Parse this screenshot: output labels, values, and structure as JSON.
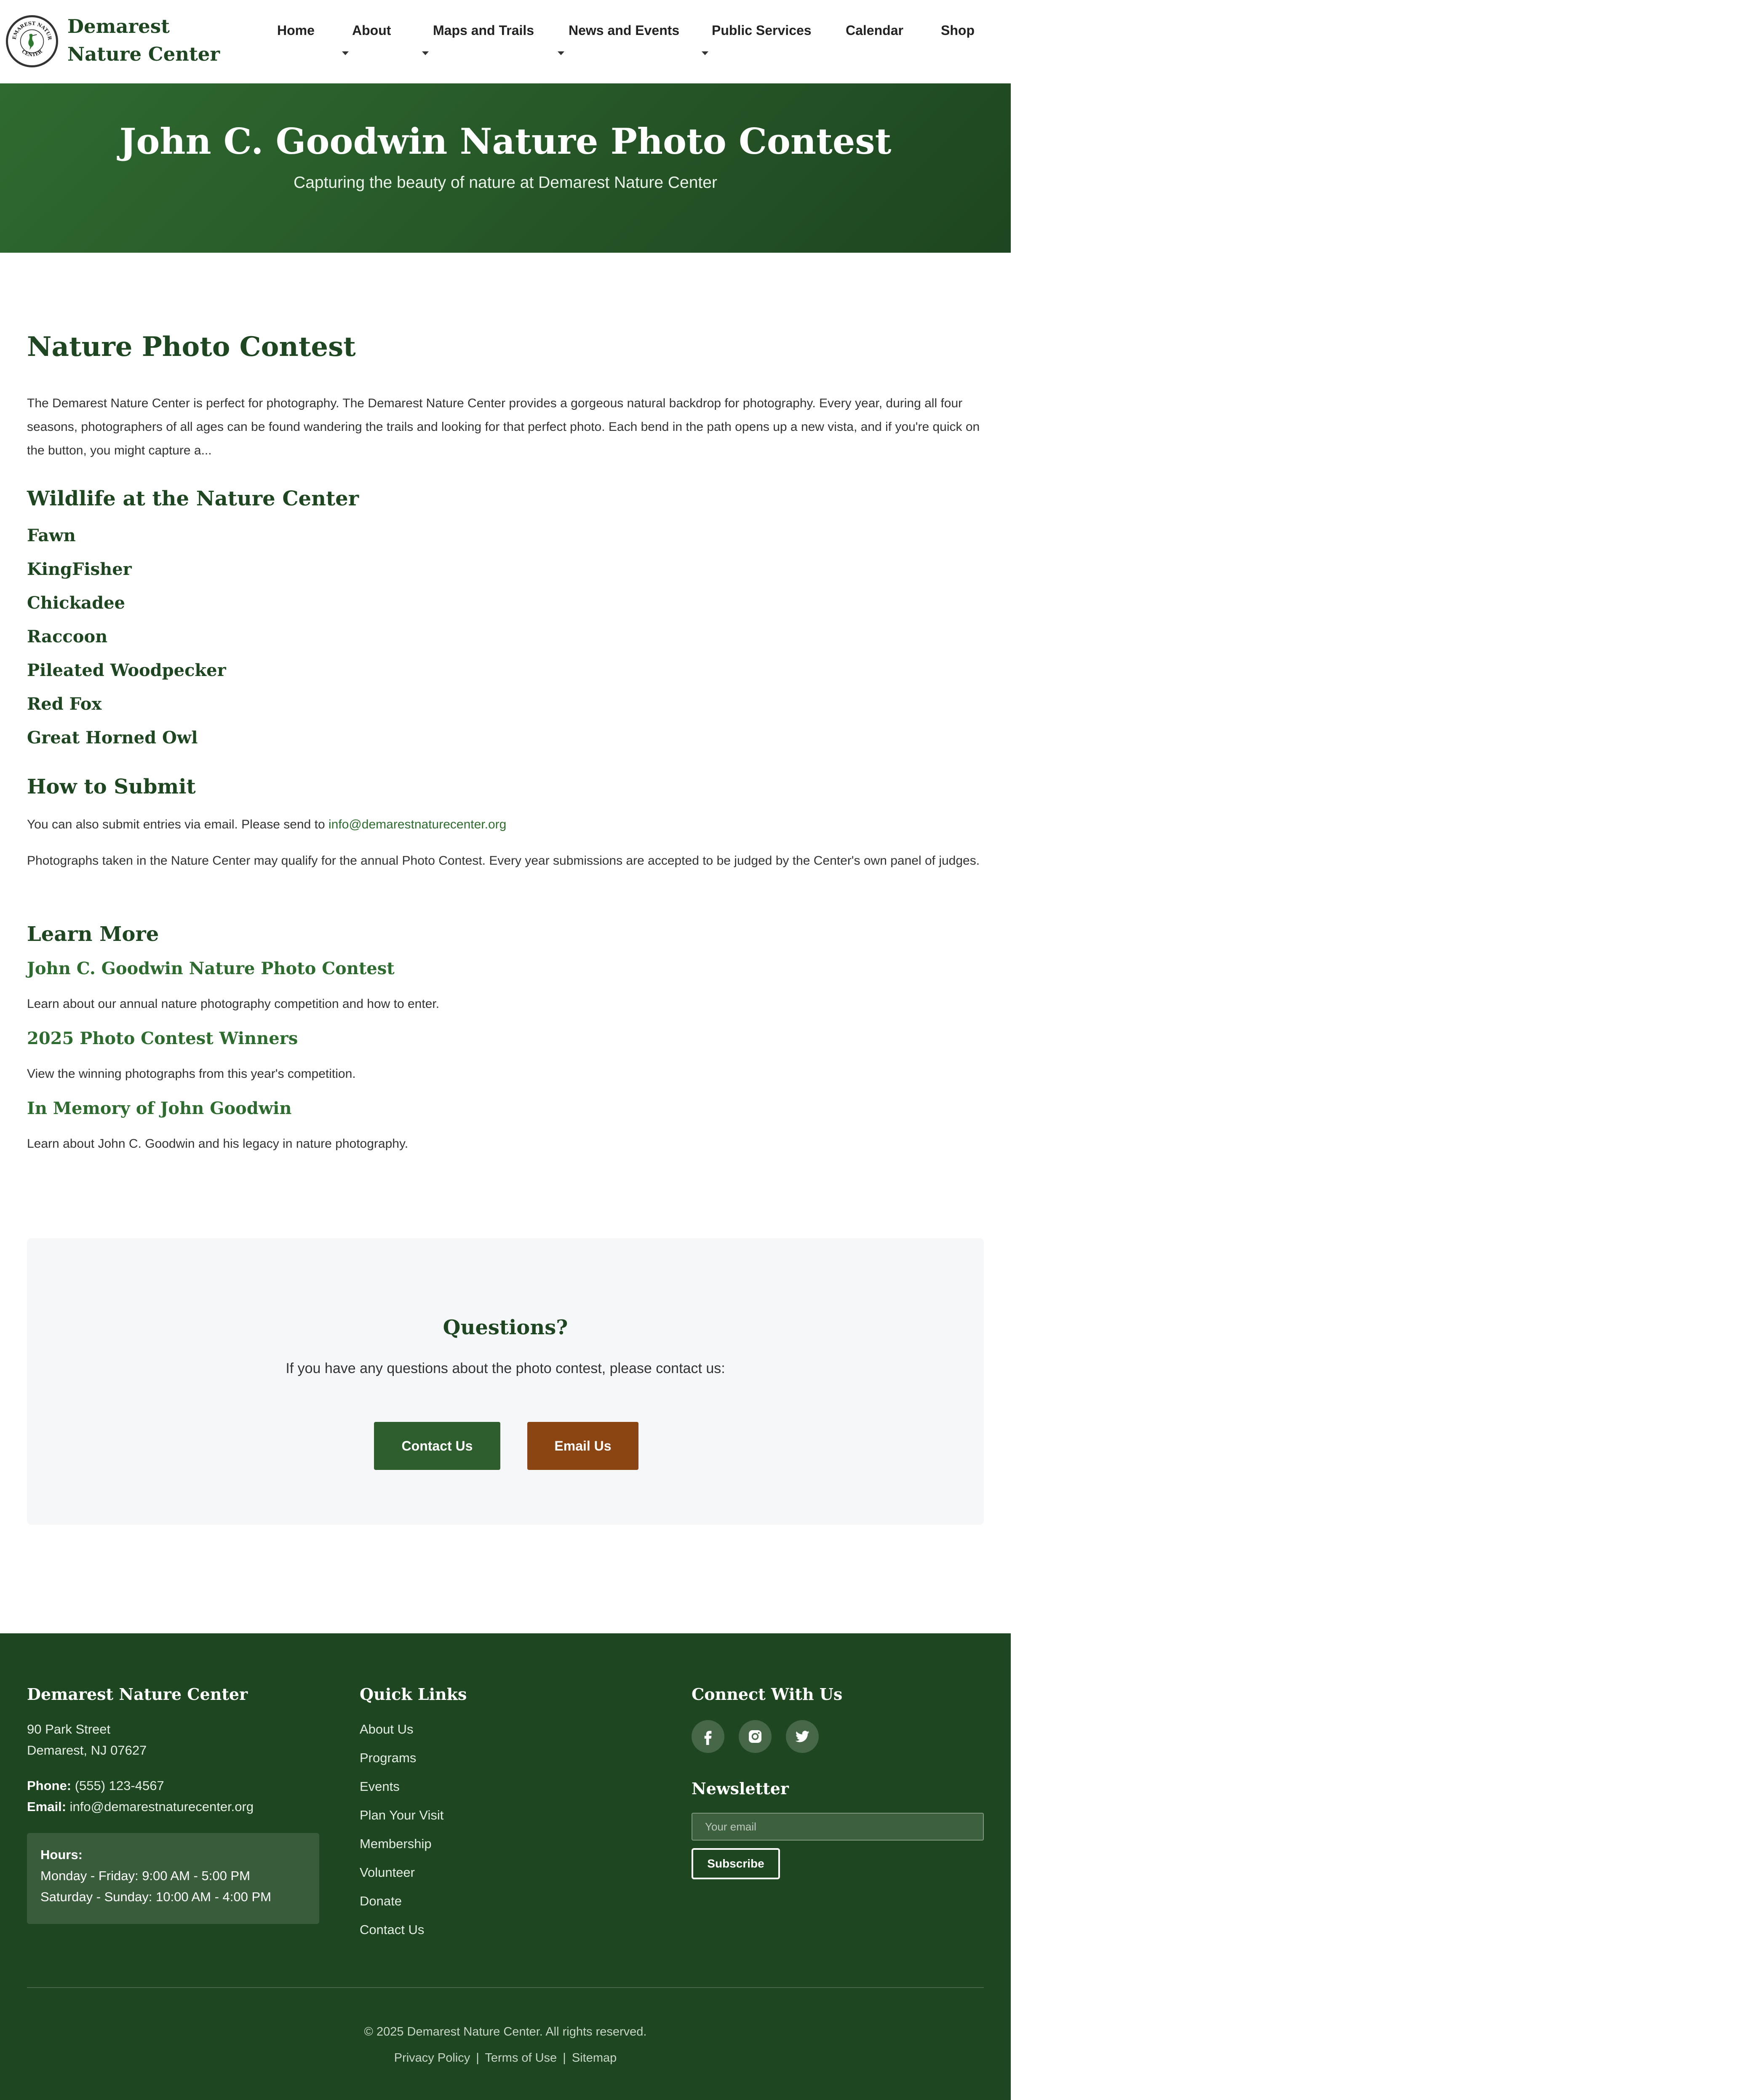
{
  "site": {
    "name": "Demarest Nature Center",
    "logo_text": "DEMAREST NATURE CENTER"
  },
  "nav": {
    "items": [
      {
        "label": "Home",
        "dropdown": false
      },
      {
        "label": "About",
        "dropdown": true
      },
      {
        "label": "Maps and Trails",
        "dropdown": true
      },
      {
        "label": "News and Events",
        "dropdown": true
      },
      {
        "label": "Public Services",
        "dropdown": true
      },
      {
        "label": "Calendar",
        "dropdown": false
      },
      {
        "label": "Shop",
        "dropdown": false
      }
    ]
  },
  "hero": {
    "title": "John C. Goodwin Nature Photo Contest",
    "subtitle": "Capturing the beauty of nature at Demarest Nature Center"
  },
  "main": {
    "heading": "Nature Photo Contest",
    "intro": "The Demarest Nature Center is perfect for photography. The Demarest Nature Center provides a gorgeous natural backdrop for photography. Every year, during all four seasons, photographers of all ages can be found wandering the trails and looking for that perfect photo. Each bend in the path opens up a new vista, and if you're quick on the button, you might capture a...",
    "wildlife_heading": "Wildlife at the Nature Center",
    "wildlife": [
      "Fawn",
      "KingFisher",
      "Chickadee",
      "Raccoon",
      "Pileated Woodpecker",
      "Red Fox",
      "Great Horned Owl"
    ],
    "submit_heading": "How to Submit",
    "submit_text": "You can also submit entries via email. Please send to",
    "submit_email": "info@demarestnaturecenter.org",
    "submit_text2": "Photographs taken in the Nature Center may qualify for the annual Photo Contest. Every year submissions are accepted to be judged by the Center's own panel of judges.",
    "learn_heading": "Learn More",
    "learn": [
      {
        "title": "John C. Goodwin Nature Photo Contest",
        "desc": "Learn about our annual nature photography competition and how to enter."
      },
      {
        "title": "2025 Photo Contest Winners",
        "desc": "View the winning photographs from this year's competition."
      },
      {
        "title": "In Memory of John Goodwin",
        "desc": "Learn about John C. Goodwin and his legacy in nature photography."
      }
    ]
  },
  "questions": {
    "title": "Questions?",
    "text": "If you have any questions about the photo contest, please contact us:",
    "contact_label": "Contact Us",
    "email_label": "Email Us"
  },
  "footer": {
    "org_heading": "Demarest Nature Center",
    "address1": "90 Park Street",
    "address2": "Demarest, NJ 07627",
    "phone_label": "Phone:",
    "phone": "(555) 123-4567",
    "email_label": "Email:",
    "email": "info@demarestnaturecenter.org",
    "hours_label": "Hours:",
    "hours_weekday": "Monday - Friday: 9:00 AM - 5:00 PM",
    "hours_weekend": "Saturday - Sunday: 10:00 AM - 4:00 PM",
    "links_heading": "Quick Links",
    "links": [
      "About Us",
      "Programs",
      "Events",
      "Plan Your Visit",
      "Membership",
      "Volunteer",
      "Donate",
      "Contact Us"
    ],
    "connect_heading": "Connect With Us",
    "social_icons": [
      "facebook-icon",
      "instagram-icon",
      "twitter-icon"
    ],
    "newsletter_heading": "Newsletter",
    "newsletter_placeholder": "Your email",
    "subscribe_label": "Subscribe",
    "copyright": "© 2025 Demarest Nature Center. All rights reserved.",
    "legal": [
      "Privacy Policy",
      "Terms of Use",
      "Sitemap"
    ],
    "legal_separator": "|"
  },
  "colors": {
    "brand_green": "#1e4620",
    "hero_green": "#2f6a30",
    "link_green": "#2e6b2f",
    "button_green": "#2e5e2e",
    "button_brown": "#8b4513",
    "panel_gray": "#f6f7f9"
  }
}
